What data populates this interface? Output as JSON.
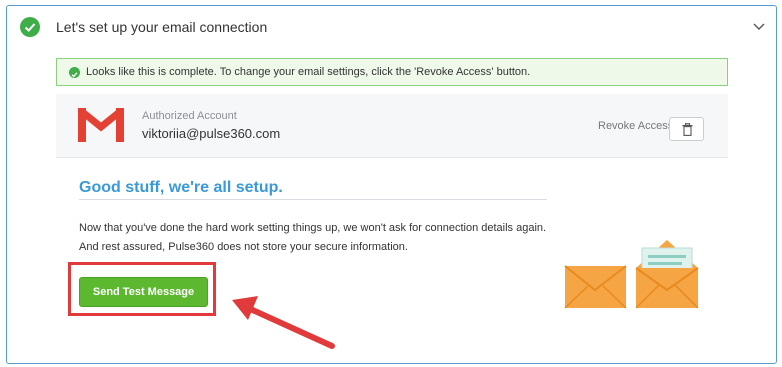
{
  "header": {
    "title": "Let's set up your email connection",
    "status_icon": "check-circle-icon",
    "toggle_icon": "chevron-down-icon"
  },
  "notice": {
    "text": "Looks like this is complete. To change your email settings, click the 'Revoke Access' button.",
    "icon": "check-circle-icon"
  },
  "account": {
    "provider_icon": "gmail-icon",
    "label": "Authorized Account",
    "email": "viktoriia@pulse360.com",
    "revoke_label": "Revoke Access",
    "revoke_icon": "trash-icon"
  },
  "setup": {
    "title": "Good stuff, we're all setup.",
    "body_line1": "Now that you've done the hard work setting things up, we won't ask for connection details again.",
    "body_line2": "And rest assured, Pulse360 does not store your secure information."
  },
  "actions": {
    "send_test_label": "Send Test Message"
  },
  "colors": {
    "success_green": "#3fae49",
    "button_green": "#5cb82f",
    "title_blue": "#3a9ad9",
    "highlight_red": "#e03a3a",
    "panel_border": "#5b9bd5"
  },
  "illustration": {
    "icon": "envelope-icon"
  }
}
